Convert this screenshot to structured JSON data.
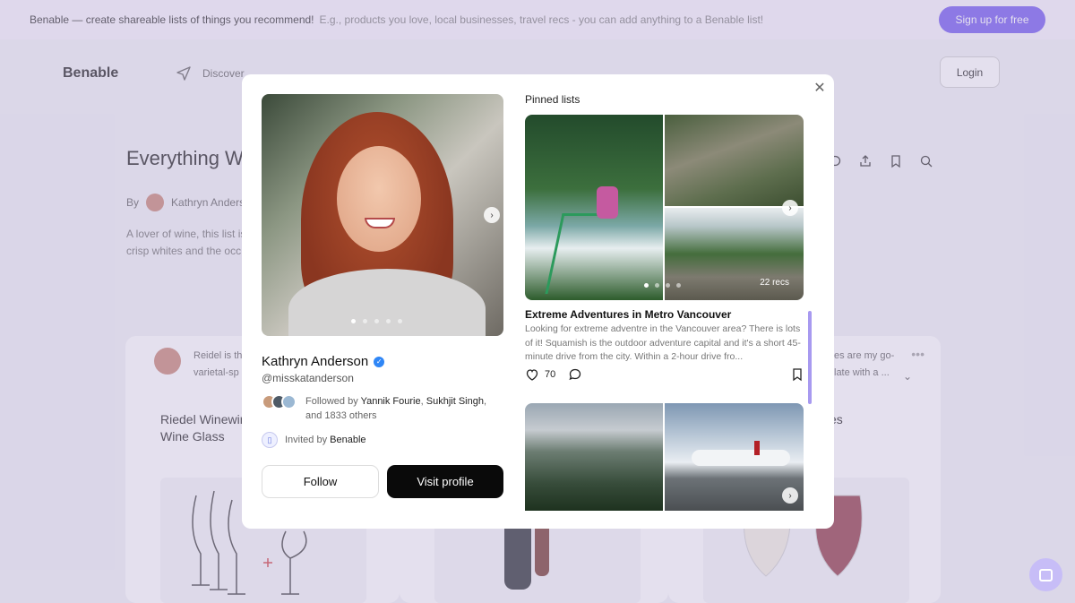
{
  "banner": {
    "headline": "Benable — create shareable lists of things you recommend!",
    "subtext": "E.g., products you love, local businesses, travel recs - you can add anything to a Benable list!",
    "signup_label": "Sign up for free"
  },
  "nav": {
    "logo": "Benable",
    "discover_label": "Discover",
    "login_label": "Login"
  },
  "list": {
    "title_partial": "Everything W",
    "by_label": "By",
    "author_partial": "Kathryn Anders",
    "desc_line1": "A lover of wine, this list is",
    "desc_line2": "crisp whites and the occ"
  },
  "cards": [
    {
      "note_line1": "Reidel is th",
      "note_line2": "varietal-sp",
      "title_line1": "Riedel Winewin",
      "title_line2": "Wine Glass"
    },
    {
      "note_line1": "",
      "note_line2": "",
      "title_line1": "",
      "title_line2": ""
    },
    {
      "note_line1": "es are my go-",
      "note_line2": "late with a ...",
      "title_line1": "es",
      "title_line2": ""
    }
  ],
  "profile": {
    "name": "Kathryn Anderson",
    "handle": "@misskatanderson",
    "followed_prefix": "Followed by",
    "follower1": "Yannik Fourie",
    "follower2": "Sukhjit Singh",
    "followed_suffix": "and 1833 others",
    "invited_prefix": "Invited by",
    "invited_by": "Benable",
    "follow_label": "Follow",
    "visit_label": "Visit profile",
    "photo_count": 5,
    "photo_active": 0
  },
  "pinned": {
    "heading": "Pinned lists",
    "lists": [
      {
        "title": "Extreme Adventures in Metro Vancouver",
        "description": "Looking for extreme adventre in the Vancouver area? There is lots of it! Squamish is the outdoor adventure capital and it's a short 45-minute drive from the city. Within a 2-hour drive fro...",
        "recs": "22 recs",
        "likes": "70"
      }
    ]
  },
  "colors": {
    "accent": "#6a4ef0",
    "verified": "#2f86f6",
    "primary_button": "#0a0a0a"
  },
  "icons": [
    "send-icon",
    "comment-icon",
    "share-icon",
    "bookmark-icon",
    "search-icon",
    "close-icon",
    "chevron-right-icon",
    "verified-icon",
    "heart-icon",
    "messenger-icon"
  ]
}
